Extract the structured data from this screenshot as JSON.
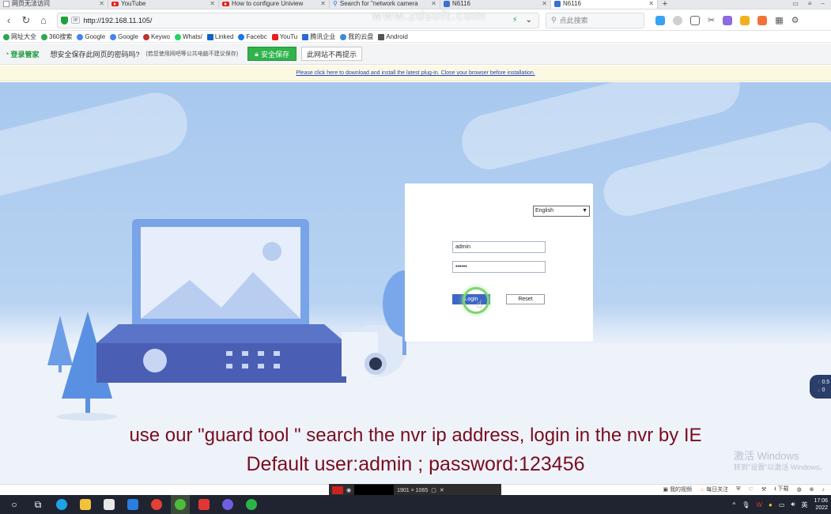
{
  "tabs": [
    {
      "label": "网页无法访问",
      "icon": "blank-page-icon"
    },
    {
      "label": "YouTube",
      "icon": "youtube-icon"
    },
    {
      "label": "How to configure Uniview",
      "icon": "youtube-icon"
    },
    {
      "label": "Search for \"network camera",
      "icon": "search-icon"
    },
    {
      "label": "N6116",
      "icon": "device-icon"
    },
    {
      "label": "N6116",
      "icon": "device-icon"
    }
  ],
  "address": {
    "url": "http://192.168.11.105/",
    "search_placeholder": "点此搜索"
  },
  "bookmarks": [
    "网址大全",
    "360搜索",
    "Google",
    "Google",
    "Keywo",
    "Whats/",
    "Linked",
    "Facebc",
    "YouTu",
    "腾讯企业",
    "我的云盘",
    "Android"
  ],
  "password_bar": {
    "brand": "登录管家",
    "question": "想安全保存此网页的密码吗?",
    "note": "(若您使用网吧等公共电脑不建议保存)",
    "save": "安全保存",
    "never": "此网站不再提示"
  },
  "plugin_notice": "Please click here to download and install the latest plug-in. Close your browser before installation.",
  "login": {
    "language": "English",
    "username": "admin",
    "password": "••••••",
    "login_btn": "Login",
    "reset_btn": "Reset"
  },
  "widget": {
    "up": "0.5",
    "down": "0"
  },
  "subtitle": {
    "line1": "use our \"guard tool \" search the nvr ip address, login in the nvr by IE",
    "line2": "Default user:admin ;  password:123456"
  },
  "watermark": {
    "top": "www.zdsoft.com",
    "line1": "激活 Windows",
    "line2": "转到\"设置\"以激活 Windows。"
  },
  "statusbar": {
    "video": "我的视频",
    "daily": "每日关注",
    "download": "下载",
    "dims": "1901 × 1065"
  },
  "taskbar": {
    "time": "17:06",
    "date": "2022",
    "lang": "英"
  },
  "colors": {
    "accent": "#3d67c6",
    "subtitle": "#7a0d1e",
    "save_green": "#2fb34a"
  }
}
